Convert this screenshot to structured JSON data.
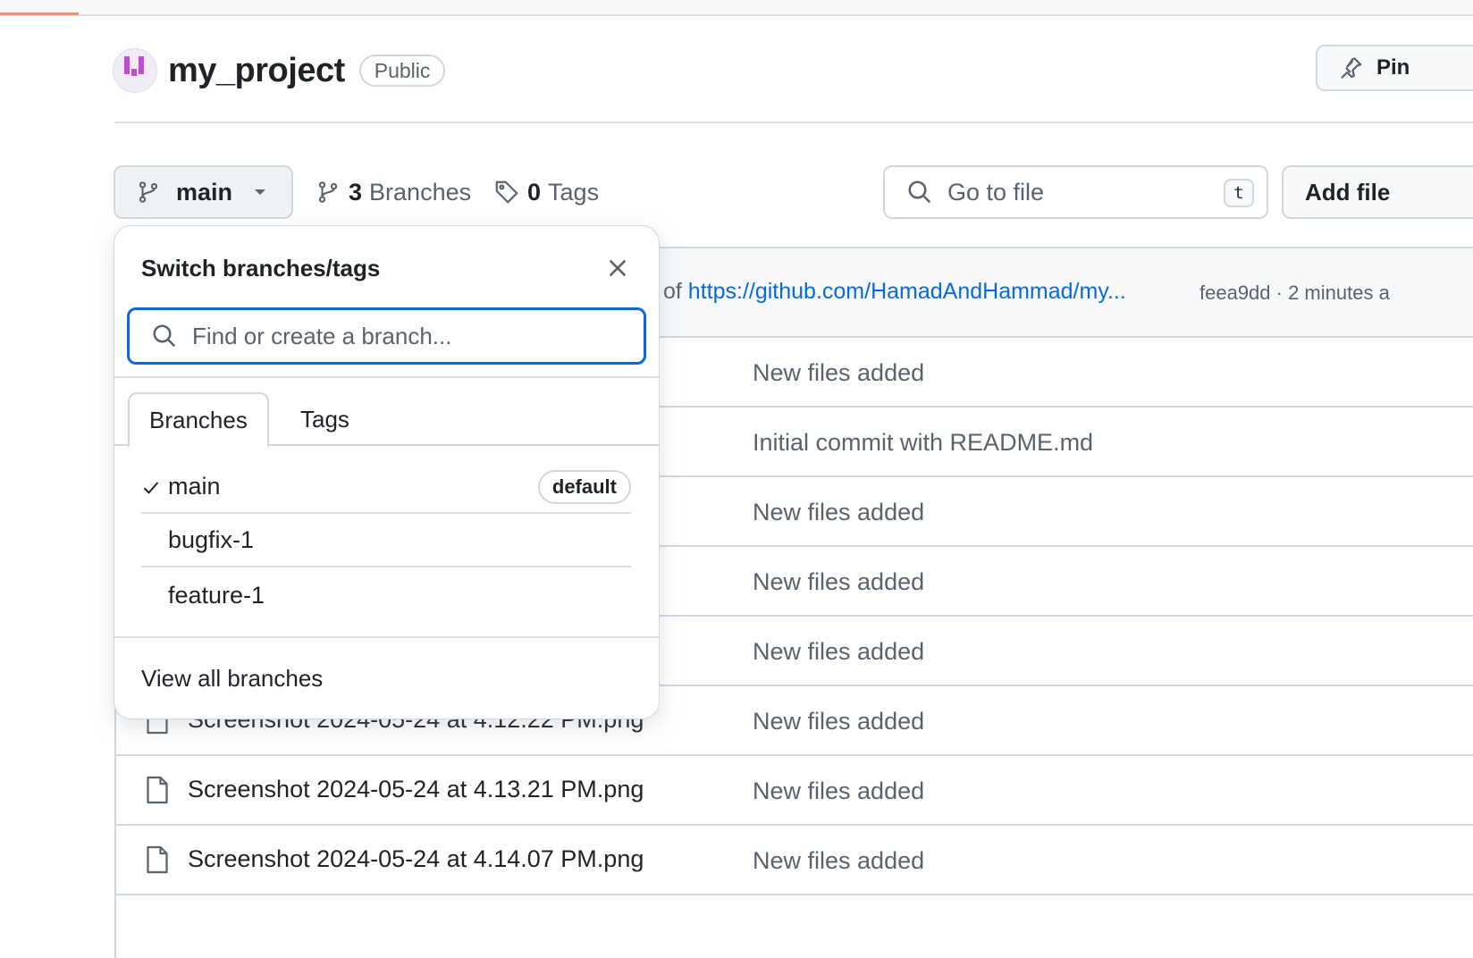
{
  "repo": {
    "name": "my_project",
    "visibility": "Public",
    "pin_label": "Pin"
  },
  "toolbar": {
    "branch_label": "main",
    "branches_count": "3",
    "branches_label": "Branches",
    "tags_count": "0",
    "tags_label": "Tags",
    "goto_placeholder": "Go to file",
    "goto_shortcut": "t",
    "add_file_label": "Add file"
  },
  "latest_commit": {
    "message_prefix": "of ",
    "link_text": "https://github.com/HamadAndHammad/my...",
    "meta": "feea9dd · 2 minutes a"
  },
  "files": [
    {
      "name": "",
      "message": "New files added"
    },
    {
      "name": "",
      "message": "Initial commit with README.md"
    },
    {
      "name": "",
      "message": "New files added"
    },
    {
      "name": "",
      "message": "New files added"
    },
    {
      "name": "",
      "message": "New files added"
    },
    {
      "name": "Screenshot 2024-05-24 at 4.12.22 PM.png",
      "message": "New files added"
    },
    {
      "name": "Screenshot 2024-05-24 at 4.13.21 PM.png",
      "message": "New files added"
    },
    {
      "name": "Screenshot 2024-05-24 at 4.14.07 PM.png",
      "message": "New files added"
    }
  ],
  "dropdown": {
    "title": "Switch branches/tags",
    "search_placeholder": "Find or create a branch...",
    "tabs": [
      "Branches",
      "Tags"
    ],
    "branches": [
      {
        "name": "main",
        "badge": "default",
        "selected": true
      },
      {
        "name": "bugfix-1"
      },
      {
        "name": "feature-1"
      }
    ],
    "view_all": "View all branches"
  },
  "colors": {
    "accent": "#0969da",
    "border": "#d0d7de",
    "muted": "#59636e",
    "progress": "#f58d6e"
  }
}
